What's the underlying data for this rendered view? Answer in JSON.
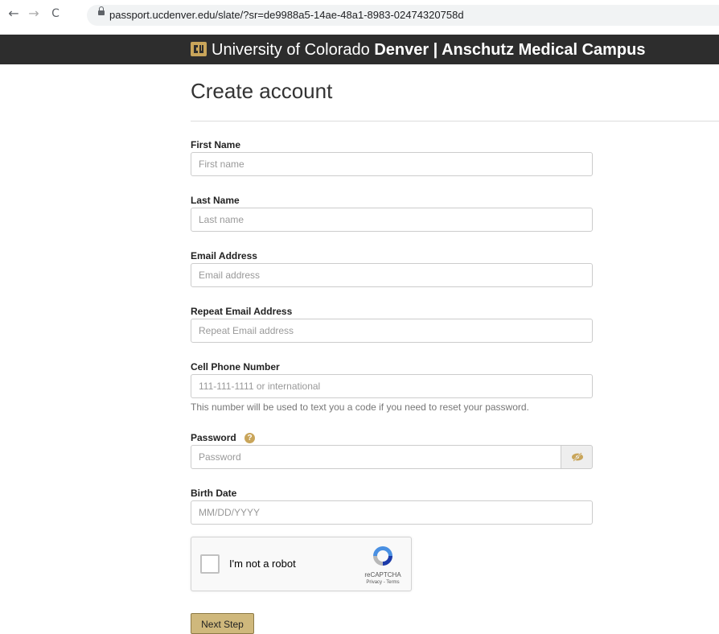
{
  "browser": {
    "url": "passport.ucdenver.edu/slate/?sr=de9988a5-14ae-48a1-8983-02474320758d",
    "back_icon": "←",
    "forward_icon": "→",
    "reload_icon": "C"
  },
  "header": {
    "title_regular": "University of Colorado ",
    "title_bold": "Denver | Anschutz Medical Campus",
    "logo_color": "#c9a55a",
    "background": "#2d2d2d"
  },
  "form": {
    "title": "Create account",
    "fields": {
      "first_name": {
        "label": "First Name",
        "placeholder": "First name",
        "value": ""
      },
      "last_name": {
        "label": "Last Name",
        "placeholder": "Last name",
        "value": ""
      },
      "email": {
        "label": "Email Address",
        "placeholder": "Email address",
        "value": ""
      },
      "email_repeat": {
        "label": "Repeat Email Address",
        "placeholder": "Repeat Email address",
        "value": ""
      },
      "phone": {
        "label": "Cell Phone Number",
        "placeholder": "111-111-1111 or international",
        "value": "",
        "help": "This number will be used to text you a code if you need to reset your password."
      },
      "password": {
        "label": "Password",
        "placeholder": "Password",
        "value": "",
        "help_icon": "?"
      },
      "birth_date": {
        "label": "Birth Date",
        "placeholder": "MM/DD/YYYY",
        "value": ""
      }
    },
    "captcha": {
      "label": "I'm not a robot",
      "brand": "reCAPTCHA",
      "terms": "Privacy - Terms"
    },
    "next_button": "Next Step",
    "accent_color": "#cfb87c"
  }
}
